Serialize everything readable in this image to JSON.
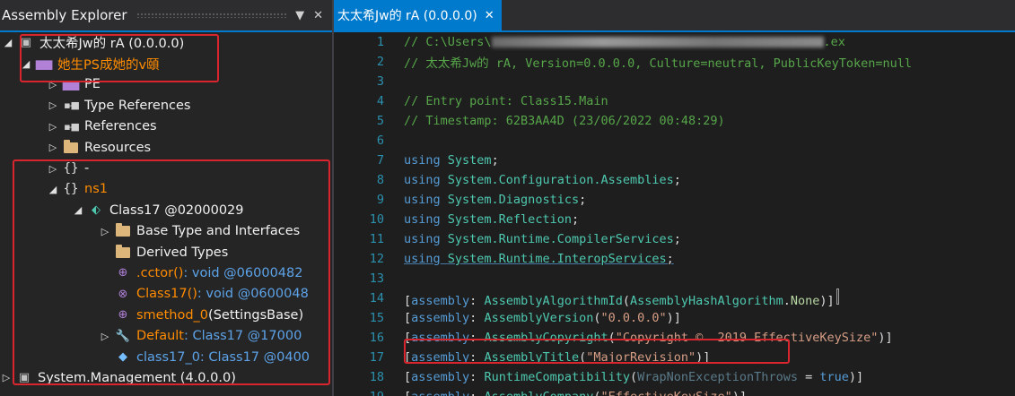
{
  "explorer": {
    "title": "Assembly Explorer",
    "dropdown_glyph": "▼",
    "close_glyph": "✕",
    "tree": [
      {
        "id": "assembly",
        "text": "太太希Jw的 rA (0.0.0.0)"
      },
      {
        "id": "module",
        "text": "她生PS成她的v頤"
      },
      {
        "id": "pe",
        "text": "PE"
      },
      {
        "id": "type-references",
        "text": "Type References"
      },
      {
        "id": "references",
        "text": "References"
      },
      {
        "id": "resources",
        "text": "Resources"
      },
      {
        "id": "ns-empty",
        "text": "-"
      },
      {
        "id": "ns1",
        "text": "ns1"
      },
      {
        "id": "class17",
        "text": "Class17 @02000029"
      },
      {
        "id": "base-types",
        "text": "Base Type and Interfaces"
      },
      {
        "id": "derived-types",
        "text": "Derived Types"
      },
      {
        "id": "cctor",
        "name": ".cctor()",
        "sig": " : void @06000482"
      },
      {
        "id": "ctor",
        "name": "Class17()",
        "sig": " : void @0600048"
      },
      {
        "id": "smethod0",
        "name": "smethod_0",
        "sig": "(SettingsBase)"
      },
      {
        "id": "default-prop",
        "name": "Default",
        "sig": " : Class17 @17000"
      },
      {
        "id": "class17-field",
        "name": "class17_0",
        "sig": " : Class17 @0400"
      },
      {
        "id": "system-management",
        "text": "System.Management (4.0.0.0)"
      }
    ]
  },
  "editor": {
    "tab_label": "太太希Jw的 rA (0.0.0.0)",
    "tab_close": "✕",
    "lines": [
      {
        "n": "1",
        "parts": [
          [
            "cm",
            "// C:\\Users\\"
          ],
          [
            "blur",
            ""
          ],
          [
            "cm",
            ".ex"
          ]
        ]
      },
      {
        "n": "2",
        "parts": [
          [
            "cm",
            "// 太太希Jw的 rA, Version=0.0.0.0, Culture=neutral, PublicKeyToken=null"
          ]
        ]
      },
      {
        "n": "3",
        "parts": []
      },
      {
        "n": "4",
        "parts": [
          [
            "cm",
            "// Entry point: Class15.Main"
          ]
        ]
      },
      {
        "n": "5",
        "parts": [
          [
            "cm",
            "// Timestamp: 62B3AA4D (23/06/2022 00:48:29)"
          ]
        ]
      },
      {
        "n": "6",
        "parts": []
      },
      {
        "n": "7",
        "parts": [
          [
            "kw",
            "using"
          ],
          [
            "src",
            " "
          ],
          [
            "ty",
            "System"
          ],
          [
            "src",
            ";"
          ]
        ]
      },
      {
        "n": "8",
        "parts": [
          [
            "kw",
            "using"
          ],
          [
            "src",
            " "
          ],
          [
            "ty",
            "System.Configuration.Assemblies"
          ],
          [
            "src",
            ";"
          ]
        ]
      },
      {
        "n": "9",
        "parts": [
          [
            "kw",
            "using"
          ],
          [
            "src",
            " "
          ],
          [
            "ty",
            "System.Diagnostics"
          ],
          [
            "src",
            ";"
          ]
        ]
      },
      {
        "n": "10",
        "parts": [
          [
            "kw",
            "using"
          ],
          [
            "src",
            " "
          ],
          [
            "ty",
            "System.Reflection"
          ],
          [
            "src",
            ";"
          ]
        ]
      },
      {
        "n": "11",
        "parts": [
          [
            "kw",
            "using"
          ],
          [
            "src",
            " "
          ],
          [
            "ty",
            "System.Runtime.CompilerServices"
          ],
          [
            "src",
            ";"
          ]
        ]
      },
      {
        "n": "12",
        "parts": [
          [
            "kw ul",
            "using"
          ],
          [
            "src ul",
            " "
          ],
          [
            "ty ul",
            "System.Runtime.InteropServices"
          ],
          [
            "src ul",
            ";"
          ]
        ]
      },
      {
        "n": "13",
        "parts": []
      },
      {
        "n": "14",
        "parts": [
          [
            "src",
            "["
          ],
          [
            "kw",
            "assembly"
          ],
          [
            "src",
            ": "
          ],
          [
            "ty",
            "AssemblyAlgorithmId"
          ],
          [
            "src",
            "("
          ],
          [
            "ty",
            "AssemblyHashAlgorithm"
          ],
          [
            "src",
            "."
          ],
          [
            "en",
            "None"
          ],
          [
            "src",
            ")]"
          ]
        ]
      },
      {
        "n": "15",
        "parts": [
          [
            "src",
            "["
          ],
          [
            "kw",
            "assembly"
          ],
          [
            "src",
            ": "
          ],
          [
            "ty",
            "AssemblyVersion"
          ],
          [
            "src",
            "("
          ],
          [
            "st",
            "\"0.0.0.0\""
          ],
          [
            "src",
            ")]"
          ]
        ]
      },
      {
        "n": "16",
        "parts": [
          [
            "src",
            "["
          ],
          [
            "kw",
            "assembly"
          ],
          [
            "src",
            ": "
          ],
          [
            "ty",
            "AssemblyCopyright"
          ],
          [
            "src",
            "("
          ],
          [
            "st",
            "\"Copyright ©  2019 EffectiveKeySize\""
          ],
          [
            "src",
            ")]"
          ]
        ]
      },
      {
        "n": "17",
        "parts": [
          [
            "src",
            "["
          ],
          [
            "kw",
            "assembly"
          ],
          [
            "src",
            ": "
          ],
          [
            "ty",
            "AssemblyTitle"
          ],
          [
            "src",
            "("
          ],
          [
            "st",
            "\"MajorRevision\""
          ],
          [
            "src",
            ")]"
          ]
        ]
      },
      {
        "n": "18",
        "parts": [
          [
            "src",
            "["
          ],
          [
            "kw",
            "assembly"
          ],
          [
            "src",
            ": "
          ],
          [
            "ty",
            "RuntimeCompatibility"
          ],
          [
            "src",
            "("
          ],
          [
            "dim",
            "WrapNonExceptionThrows"
          ],
          [
            "src",
            " = "
          ],
          [
            "kw",
            "true"
          ],
          [
            "src",
            ")]"
          ]
        ]
      },
      {
        "n": "19",
        "parts": [
          [
            "src",
            "["
          ],
          [
            "kw",
            "assembly"
          ],
          [
            "src",
            ": "
          ],
          [
            "ty",
            "AssemblyCompany"
          ],
          [
            "src",
            "("
          ],
          [
            "st",
            "\"EffectiveKeySize\""
          ],
          [
            "src",
            ")]"
          ]
        ]
      }
    ]
  },
  "colors": {
    "highlight_box": "#d9262e",
    "accent": "#007acc"
  }
}
